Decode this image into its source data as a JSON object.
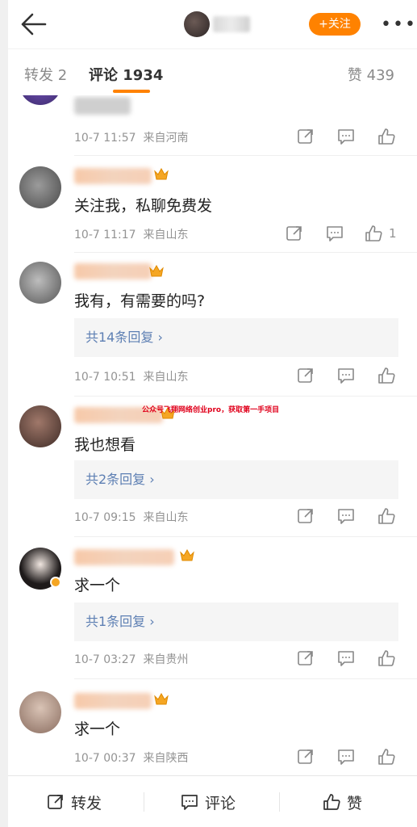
{
  "header": {
    "follow_label": "+关注",
    "more_label": "•••",
    "icons": {
      "back": "arrow-left-icon",
      "more": "more-dots-icon"
    }
  },
  "tabs": {
    "repost": "转发 2",
    "comments": "评论 1934",
    "likes": "赞 439",
    "accent": "#ff8200"
  },
  "comments": [
    {
      "text": "",
      "time": "10-7 11:57",
      "source": "来自河南",
      "likes": ""
    },
    {
      "text": "关注我，私聊免费发",
      "time": "10-7 11:17",
      "source": "来自山东",
      "likes": "1"
    },
    {
      "text": "我有，有需要的吗?",
      "replies": "共14条回复 ›",
      "time": "10-7 10:51",
      "source": "来自山东",
      "likes": ""
    },
    {
      "text": "我也想看",
      "replies": "共2条回复 ›",
      "time": "10-7 09:15",
      "source": "来自山东",
      "likes": ""
    },
    {
      "text": "求一个",
      "replies": "共1条回复 ›",
      "time": "10-7 03:27",
      "source": "来自贵州",
      "likes": ""
    },
    {
      "text": "求一个",
      "time": "10-7 00:37",
      "source": "来自陕西",
      "likes": ""
    }
  ],
  "watermark": "公众号飞翔网络创业pro，获取第一手项目",
  "bottombar": {
    "repost": "转发",
    "comment": "评论",
    "like": "赞"
  },
  "colors": {
    "link": "#5d7fb3",
    "meta": "#939393",
    "accent": "#ff8200"
  }
}
